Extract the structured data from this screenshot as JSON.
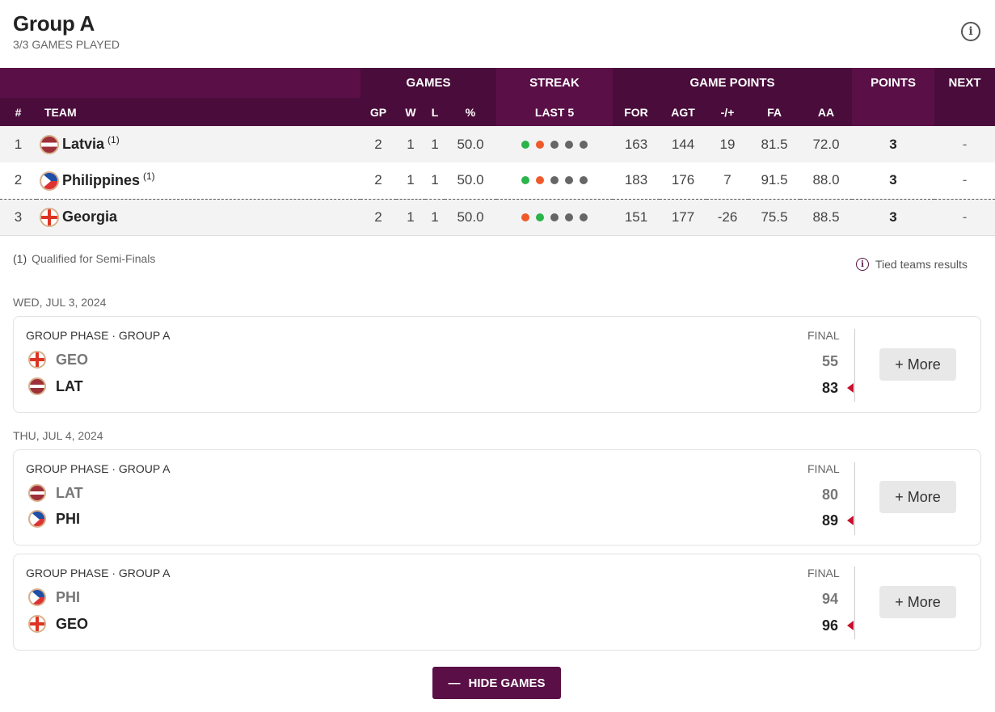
{
  "header": {
    "title": "Group A",
    "subtitle": "3/3 GAMES PLAYED",
    "info_icon": "info-icon"
  },
  "table": {
    "groups": {
      "games": "GAMES",
      "streak": "STREAK",
      "game_points": "GAME POINTS",
      "points": "POINTS",
      "next": "NEXT"
    },
    "columns": {
      "rank": "#",
      "team": "TEAM",
      "gp": "GP",
      "w": "W",
      "l": "L",
      "pct": "%",
      "last5": "LAST 5",
      "for": "FOR",
      "agt": "AGT",
      "diff": "-/+",
      "fa": "FA",
      "aa": "AA"
    },
    "rows": [
      {
        "rank": "1",
        "team": "Latvia",
        "flag": "lat",
        "qual": "(1)",
        "gp": "2",
        "w": "1",
        "l": "1",
        "pct": "50.0",
        "streak": [
          "W",
          "L",
          "-",
          "-",
          "-"
        ],
        "for": "163",
        "agt": "144",
        "diff": "19",
        "fa": "81.5",
        "aa": "72.0",
        "points": "3",
        "next": "-"
      },
      {
        "rank": "2",
        "team": "Philippines",
        "flag": "phi",
        "qual": "(1)",
        "gp": "2",
        "w": "1",
        "l": "1",
        "pct": "50.0",
        "streak": [
          "W",
          "L",
          "-",
          "-",
          "-"
        ],
        "for": "183",
        "agt": "176",
        "diff": "7",
        "fa": "91.5",
        "aa": "88.0",
        "points": "3",
        "next": "-"
      },
      {
        "rank": "3",
        "team": "Georgia",
        "flag": "geo",
        "qual": "",
        "gp": "2",
        "w": "1",
        "l": "1",
        "pct": "50.0",
        "streak": [
          "L",
          "W",
          "-",
          "-",
          "-"
        ],
        "for": "151",
        "agt": "177",
        "diff": "-26",
        "fa": "75.5",
        "aa": "88.5",
        "points": "3",
        "next": "-"
      }
    ]
  },
  "legend": {
    "marker": "(1)",
    "text": "Qualified for Semi-Finals"
  },
  "tied": {
    "label": "Tied teams results"
  },
  "dates": [
    "WED, JUL 3, 2024",
    "THU, JUL 4, 2024"
  ],
  "games": [
    {
      "phase": "GROUP PHASE · GROUP A",
      "status": "FINAL",
      "team1": {
        "abbr": "GEO",
        "flag": "geo",
        "score": "55"
      },
      "team2": {
        "abbr": "LAT",
        "flag": "lat",
        "score": "83"
      },
      "more": "+ More"
    },
    {
      "phase": "GROUP PHASE · GROUP A",
      "status": "FINAL",
      "team1": {
        "abbr": "LAT",
        "flag": "lat",
        "score": "80"
      },
      "team2": {
        "abbr": "PHI",
        "flag": "phi",
        "score": "89"
      },
      "more": "+ More"
    },
    {
      "phase": "GROUP PHASE · GROUP A",
      "status": "FINAL",
      "team1": {
        "abbr": "PHI",
        "flag": "phi",
        "score": "94"
      },
      "team2": {
        "abbr": "GEO",
        "flag": "geo",
        "score": "96"
      },
      "more": "+ More"
    }
  ],
  "hide_button": {
    "label": "HIDE GAMES"
  },
  "colors": {
    "brand": "#5a1047",
    "brand_dark": "#4a0d3b",
    "win": "#2bb44a",
    "loss": "#ef5a2a",
    "pending": "#666666",
    "winner_marker": "#c8102e"
  }
}
